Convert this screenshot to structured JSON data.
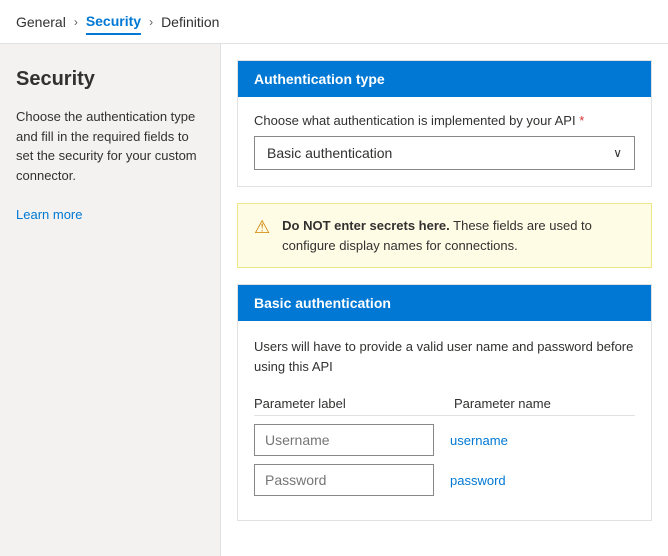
{
  "breadcrumb": {
    "items": [
      {
        "label": "General",
        "active": false
      },
      {
        "label": "Security",
        "active": true
      },
      {
        "label": "Definition",
        "active": false
      }
    ]
  },
  "sidebar": {
    "title": "Security",
    "description_line1": "Choose the authentication type and fill in the",
    "description_line2": "required fields to set the security for your",
    "description_line3": "custom connector.",
    "learn_more_label": "Learn more"
  },
  "auth_type_section": {
    "header": "Authentication type",
    "field_label": "Choose what authentication is implemented by your API",
    "required": "*",
    "selected_value": "Basic authentication"
  },
  "warning": {
    "icon": "⚠",
    "text_bold": "Do NOT enter secrets here.",
    "text_rest": " These fields are used to configure display names for connections."
  },
  "basic_auth_section": {
    "header": "Basic authentication",
    "description": "Users will have to provide a valid user name and password before using this API",
    "param_label_header": "Parameter label",
    "param_name_header": "Parameter name",
    "params": [
      {
        "label_placeholder": "Username",
        "name_value": "username"
      },
      {
        "label_placeholder": "Password",
        "name_value": "password"
      }
    ]
  }
}
